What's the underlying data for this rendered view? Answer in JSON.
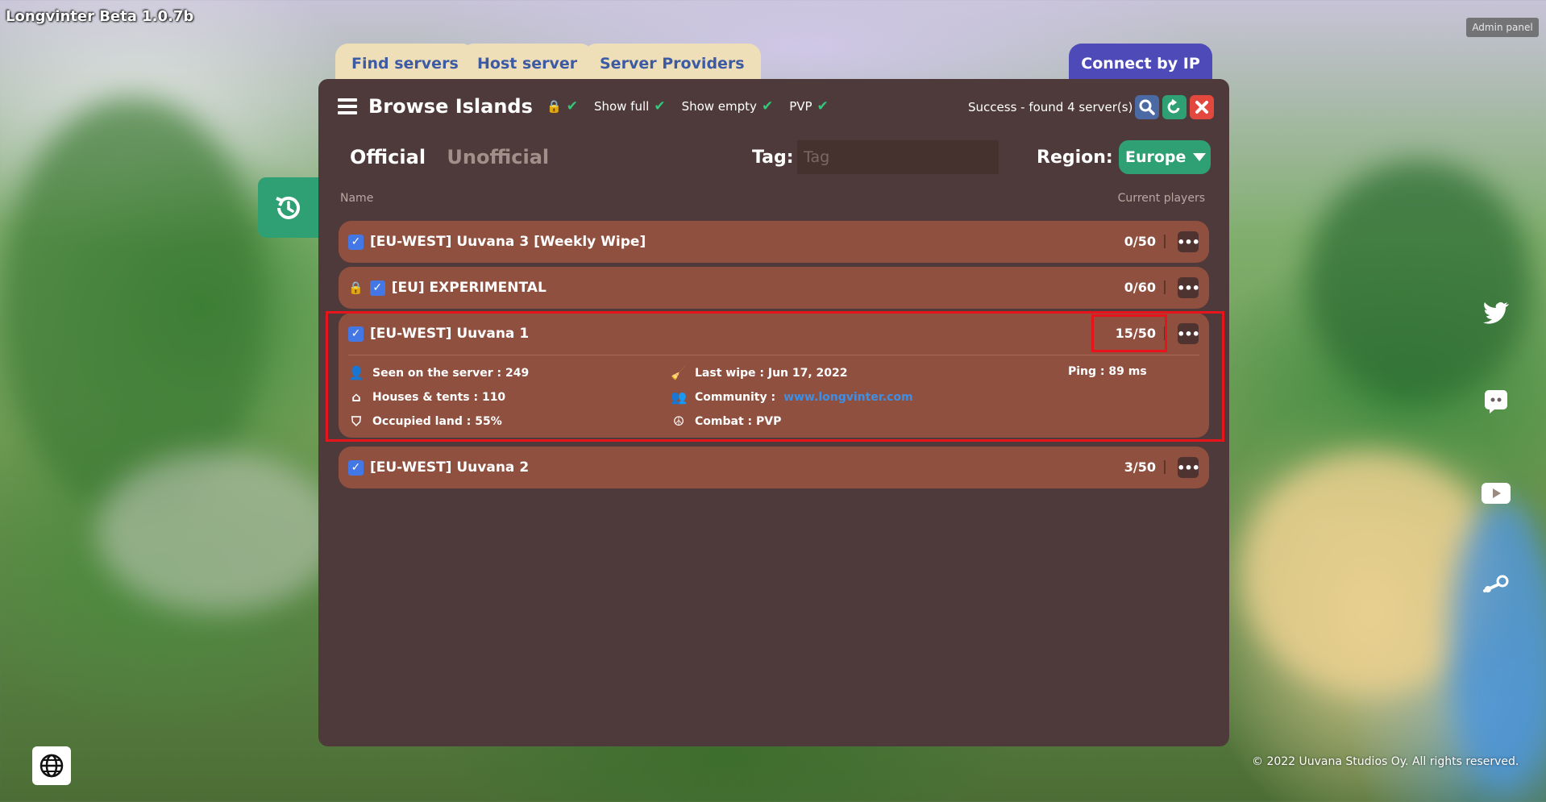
{
  "app": {
    "title": "Longvinter Beta 1.0.7b",
    "admin_panel": "Admin panel"
  },
  "tabs": {
    "find": "Find servers",
    "host": "Host server",
    "providers": "Server Providers",
    "connect": "Connect by IP"
  },
  "browser": {
    "title": "Browse Islands",
    "filters": {
      "show_full": "Show full",
      "show_empty": "Show empty",
      "pvp": "PVP"
    },
    "status": "Success - found 4 server(s)",
    "kind_official": "Official",
    "kind_unofficial": "Unofficial",
    "tag_label": "Tag:",
    "tag_placeholder": "Tag",
    "region_label": "Region:",
    "region_value": "Europe",
    "col_name": "Name",
    "col_players": "Current players"
  },
  "servers": [
    {
      "name": "[EU-WEST] Uuvana 3 [Weekly Wipe]",
      "players": "0/50",
      "locked": false
    },
    {
      "name": "[EU] EXPERIMENTAL",
      "players": "0/60",
      "locked": true
    },
    {
      "name": "[EU-WEST] Uuvana 1",
      "players": "15/50",
      "locked": false,
      "details": {
        "seen": "Seen on the server : 249",
        "houses": "Houses & tents : 110",
        "occupied": "Occupied land : 55%",
        "last_wipe": "Last wipe : Jun 17, 2022",
        "community_label": "Community :",
        "community_url": "www.longvinter.com",
        "combat": "Combat : PVP",
        "ping": "Ping : 89 ms"
      }
    },
    {
      "name": "[EU-WEST] Uuvana 2",
      "players": "3/50",
      "locked": false
    }
  ],
  "footer": {
    "copyright": "© 2022 Uuvana Studios Oy. All rights reserved."
  },
  "colors": {
    "accent_green": "#2f9f74",
    "panel": "#4e3a3a",
    "row": "#8f503f",
    "highlight": "#e8141c"
  }
}
